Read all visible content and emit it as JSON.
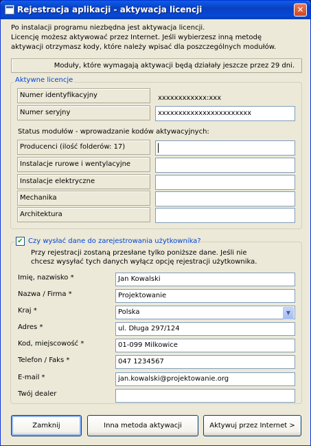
{
  "window": {
    "title": "Rejestracja aplikacji - aktywacja licencji",
    "close_glyph": "✕"
  },
  "intro": {
    "line1": "Po instalacji programu niezbędna jest aktywacja licencji.",
    "line2": "Licencję możesz aktywować przez Internet. Jeśli wybierzesz inną metodę",
    "line3": "aktywacji otrzymasz kody, które należy wpisać dla poszczególnych modułów."
  },
  "notice": "Moduły, które wymagają aktywacji będą działały jeszcze przez 29 dni.",
  "licenses": {
    "legend": "Aktywne licencje",
    "id_label": "Numer identyfikacyjny",
    "id_value": "xxxxxxxxxxxx:xxx",
    "serial_label": "Numer seryjny",
    "serial_value": "xxxxxxxxxxxxxxxxxxxxxxx",
    "modules_heading": "Status modułów - wprowadzanie kodów aktywacyjnych:",
    "modules": [
      {
        "label": "Producenci (ilość folderów: 17)",
        "value": ""
      },
      {
        "label": "Instalacje rurowe i wentylacyjne",
        "value": ""
      },
      {
        "label": "Instalacje elektryczne",
        "value": ""
      },
      {
        "label": "Mechanika",
        "value": ""
      },
      {
        "label": "Architektura",
        "value": ""
      }
    ]
  },
  "registration": {
    "checkbox_label": "Czy wysłać dane do zarejestrowania użytkownika?",
    "checked": true,
    "check_glyph": "✔",
    "info1": "Przy rejestracji zostaną przesłane tylko poniższe dane. Jeśli nie",
    "info2": "chcesz wysyłać tych danych wyłącz opcję rejestracji użytkownika.",
    "fields": [
      {
        "label": "Imię, nazwisko *",
        "value": "Jan Kowalski"
      },
      {
        "label": "Nazwa / Firma *",
        "value": "Projektowanie"
      },
      {
        "label": "Kraj *",
        "value": "Polska"
      },
      {
        "label": "Adres *",
        "value": "ul. Długa 297/124"
      },
      {
        "label": "Kod, miejscowość *",
        "value": "01-099 Milkowice"
      },
      {
        "label": "Telefon / Faks *",
        "value": "047 1234567"
      },
      {
        "label": "E-mail *",
        "value": "jan.kowalski@projektowanie.org"
      },
      {
        "label": "Twój dealer",
        "value": ""
      }
    ],
    "dropdown_glyph": "▼"
  },
  "buttons": {
    "close": "Zamknij",
    "other_method": "Inna metoda aktywacji",
    "activate_internet": "Aktywuj przez Internet >"
  }
}
